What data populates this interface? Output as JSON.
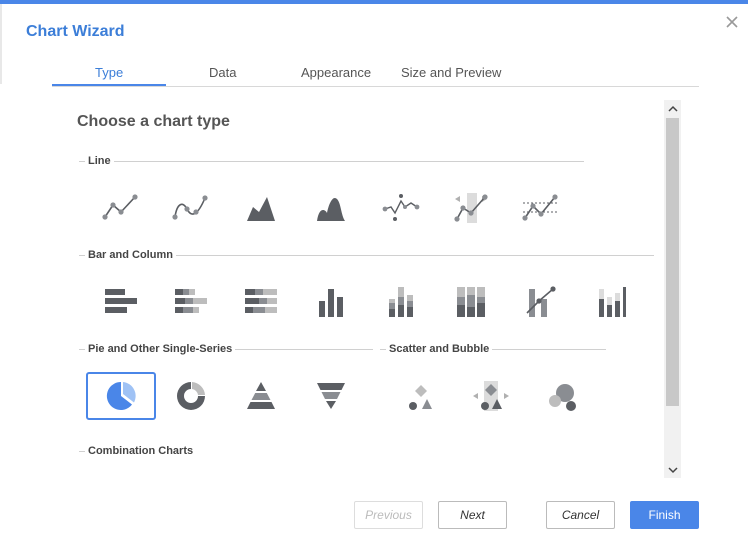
{
  "dialog": {
    "title": "Chart Wizard"
  },
  "tabs": [
    {
      "label": "Type"
    },
    {
      "label": "Data"
    },
    {
      "label": "Appearance"
    },
    {
      "label": "Size and Preview"
    }
  ],
  "main": {
    "heading": "Choose a chart type",
    "groups": {
      "line": "Line",
      "bar": "Bar and Column",
      "pie": "Pie and Other Single-Series",
      "scatter": "Scatter and Bubble",
      "combo": "Combination Charts"
    }
  },
  "icons": {
    "line": [
      "line-chart-icon",
      "smooth-line-chart-icon",
      "area-chart-icon",
      "smooth-area-chart-icon",
      "scatter-line-chart-icon",
      "highlighted-line-chart-icon",
      "target-line-chart-icon"
    ],
    "bar": [
      "bar-chart-icon",
      "stacked-bar-chart-icon",
      "percent-stacked-bar-chart-icon",
      "column-chart-icon",
      "stacked-column-chart-icon",
      "percent-stacked-column-chart-icon",
      "column-line-combo-icon",
      "range-column-chart-icon"
    ],
    "pie": [
      "pie-chart-icon",
      "donut-chart-icon",
      "pyramid-chart-icon",
      "funnel-chart-icon"
    ],
    "scatter": [
      "scatter-chart-icon",
      "highlighted-scatter-chart-icon",
      "bubble-chart-icon"
    ]
  },
  "colors": {
    "accent": "#4a86e8",
    "icon": "#5b5e63",
    "icon_light": "#b9b9b9"
  },
  "footer": {
    "previous": "Previous",
    "next": "Next",
    "cancel": "Cancel",
    "finish": "Finish"
  }
}
